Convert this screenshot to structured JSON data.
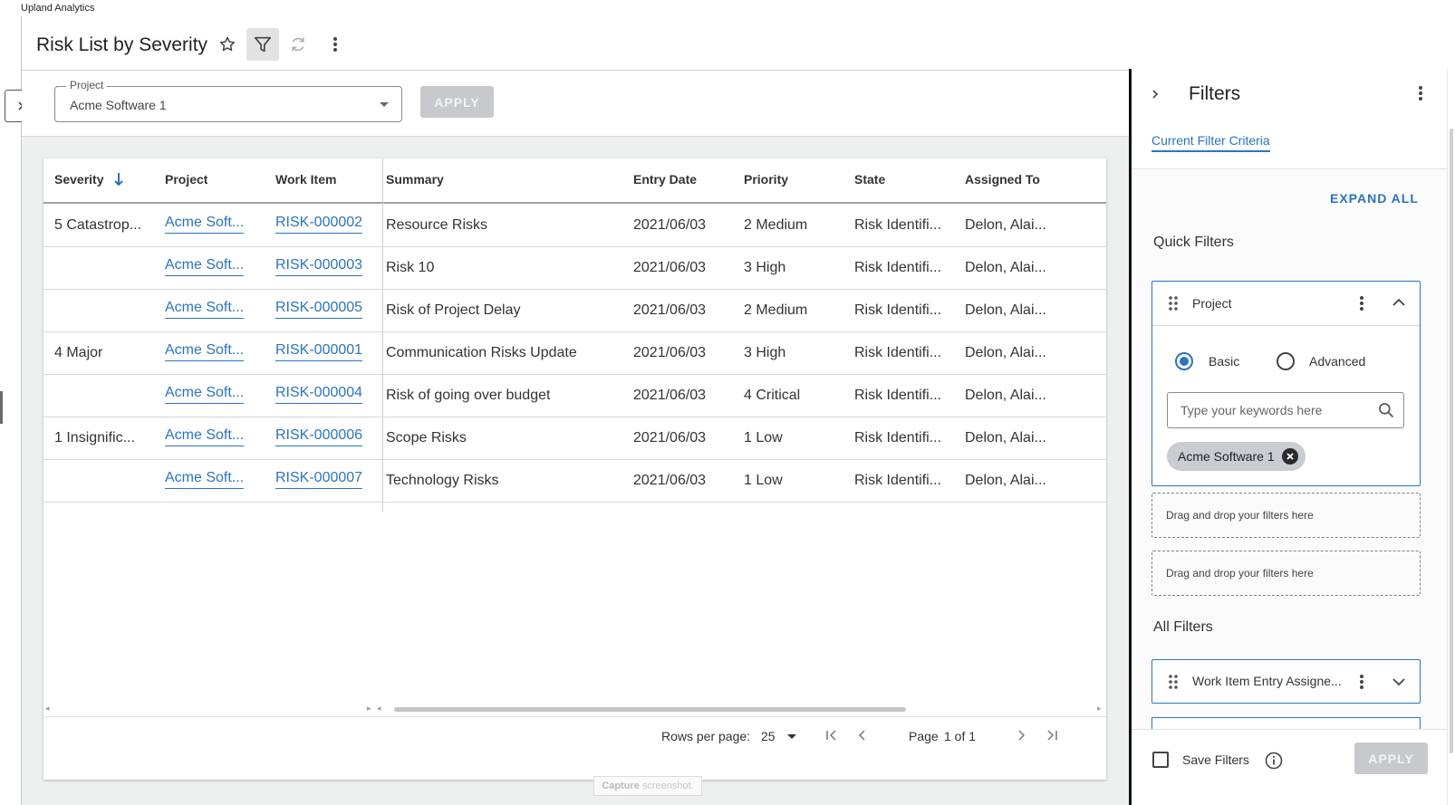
{
  "app": {
    "name": "Upland Analytics"
  },
  "header": {
    "title": "Risk List by Severity"
  },
  "toolbar": {
    "project_label": "Project",
    "project_value": "Acme Software 1",
    "apply_label": "APPLY"
  },
  "table": {
    "columns": [
      "Severity",
      "Project",
      "Work Item",
      "Summary",
      "Entry Date",
      "Priority",
      "State",
      "Assigned To"
    ],
    "sorted_column": "Severity",
    "sort_direction": "descending",
    "rows": [
      {
        "severity": "5 Catastrop...",
        "project": "Acme Soft...",
        "work_item": "RISK-000002",
        "summary": "Resource Risks",
        "entry_date": "2021/06/03",
        "priority": "2 Medium",
        "state": "Risk Identifi...",
        "assigned_to": "Delon, Alai..."
      },
      {
        "severity": "",
        "project": "Acme Soft...",
        "work_item": "RISK-000003",
        "summary": "Risk 10",
        "entry_date": "2021/06/03",
        "priority": "3 High",
        "state": "Risk Identifi...",
        "assigned_to": "Delon, Alai..."
      },
      {
        "severity": "",
        "project": "Acme Soft...",
        "work_item": "RISK-000005",
        "summary": "Risk of Project Delay",
        "entry_date": "2021/06/03",
        "priority": "2 Medium",
        "state": "Risk Identifi...",
        "assigned_to": "Delon, Alai..."
      },
      {
        "severity": "4 Major",
        "project": "Acme Soft...",
        "work_item": "RISK-000001",
        "summary": "Communication Risks Update",
        "entry_date": "2021/06/03",
        "priority": "3 High",
        "state": "Risk Identifi...",
        "assigned_to": "Delon, Alai..."
      },
      {
        "severity": "",
        "project": "Acme Soft...",
        "work_item": "RISK-000004",
        "summary": "Risk of going over budget",
        "entry_date": "2021/06/03",
        "priority": "4 Critical",
        "state": "Risk Identifi...",
        "assigned_to": "Delon, Alai..."
      },
      {
        "severity": "1 Insignific...",
        "project": "Acme Soft...",
        "work_item": "RISK-000006",
        "summary": "Scope Risks",
        "entry_date": "2021/06/03",
        "priority": "1 Low",
        "state": "Risk Identifi...",
        "assigned_to": "Delon, Alai..."
      },
      {
        "severity": "",
        "project": "Acme Soft...",
        "work_item": "RISK-000007",
        "summary": "Technology Risks",
        "entry_date": "2021/06/03",
        "priority": "1 Low",
        "state": "Risk Identifi...",
        "assigned_to": "Delon, Alai..."
      }
    ]
  },
  "pager": {
    "rows_per_page_label": "Rows per page:",
    "rows_per_page": "25",
    "page_label": "Page",
    "page_value": "1 of 1"
  },
  "capture": {
    "bold": "Capture",
    "rest": "screenshot."
  },
  "filters": {
    "title": "Filters",
    "tab": "Current Filter Criteria",
    "expand_all": "EXPAND ALL",
    "quick_title": "Quick Filters",
    "project_filter": {
      "label": "Project",
      "mode_basic": "Basic",
      "mode_advanced": "Advanced",
      "selected_mode": "Basic",
      "keyword_placeholder": "Type your keywords here",
      "chip": "Acme Software 1"
    },
    "dropzone_text": "Drag and drop your filters here",
    "all_title": "All Filters",
    "all_first": "Work Item Entry Assigne...",
    "save_label": "Save Filters",
    "apply_label": "APPLY"
  },
  "colors": {
    "accent": "#2a74c5",
    "disabled_button": "#c7c9cc",
    "chip": "#c9ccd0"
  },
  "icons": [
    "star-icon",
    "filter-icon",
    "refresh-icon",
    "kebab-menu-icon",
    "chevron-right-icon",
    "sort-arrow-down-icon",
    "caret-down-icon",
    "first-page-icon",
    "prev-page-icon",
    "next-page-icon",
    "last-page-icon",
    "drag-handle-icon",
    "chevron-up-icon",
    "chevron-down-icon",
    "search-icon",
    "close-circle-icon",
    "info-icon"
  ]
}
